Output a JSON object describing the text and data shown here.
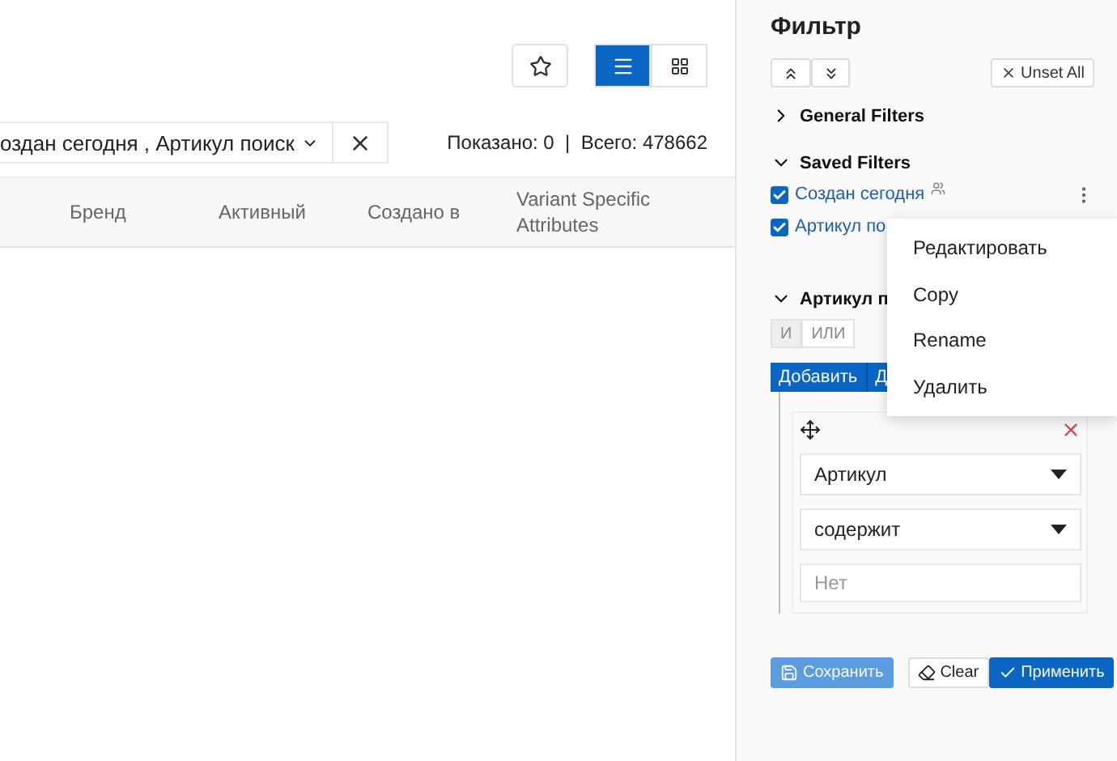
{
  "toolbar": {
    "view_modes": [
      {
        "kind": "list",
        "selected": true
      },
      {
        "kind": "grid",
        "selected": false
      }
    ]
  },
  "filter_select": {
    "value": "оздан сегодня , Артикул поиск"
  },
  "summary": {
    "shown": "Показано: 0",
    "separator": "|",
    "total": "Всего: 478662"
  },
  "table": {
    "columns": [
      "Бренд",
      "Активный",
      "Создано в",
      "Variant Specific Attributes"
    ]
  },
  "panel": {
    "title": "Фильтр",
    "unset_all": "Unset All",
    "sections": [
      {
        "title": "General Filters",
        "expanded": false
      },
      {
        "title": "Saved Filters",
        "expanded": true
      }
    ],
    "saved_filters": [
      {
        "label": "Создан сегодня",
        "checked": true,
        "shared": true
      },
      {
        "label": "Артикул по",
        "checked": true,
        "shared": false
      }
    ],
    "group": {
      "title": "Артикул п",
      "expanded": true,
      "conjunctions": [
        {
          "label": "И",
          "selected": true
        },
        {
          "label": "ИЛИ",
          "selected": false
        }
      ],
      "add_buttons": [
        "Добавить",
        "Д"
      ],
      "rule": {
        "field": "Артикул",
        "operator": "содержит",
        "value_placeholder": "Нет"
      }
    },
    "buttons": [
      {
        "kind": "save",
        "label": "Сохранить"
      },
      {
        "kind": "clear",
        "label": "Clear"
      },
      {
        "kind": "apply",
        "label": "Применить"
      }
    ]
  },
  "context_menu": [
    "Редактировать",
    "Copy",
    "Rename",
    "Удалить"
  ]
}
